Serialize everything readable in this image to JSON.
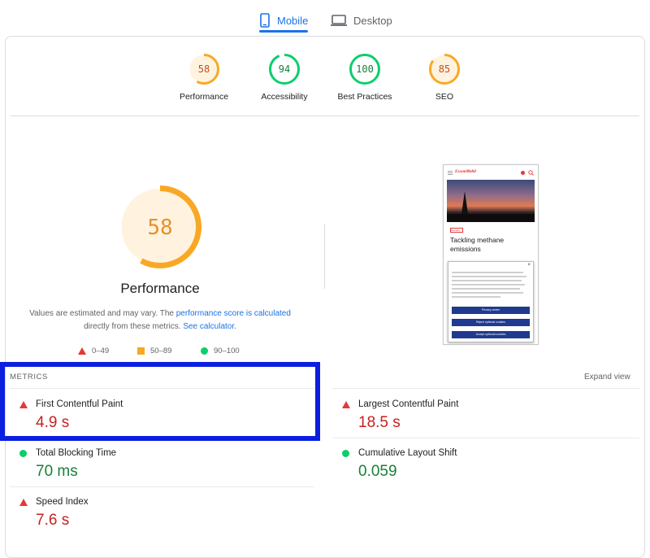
{
  "tabs": {
    "mobile": "Mobile",
    "desktop": "Desktop"
  },
  "categories": [
    {
      "score": "58",
      "label": "Performance",
      "value": 0.58,
      "color": "#f9a825",
      "fill": "#fff3e0",
      "text": "#c0501f"
    },
    {
      "score": "94",
      "label": "Accessibility",
      "value": 0.94,
      "color": "#0cce6b",
      "fill": "#ffffff",
      "text": "#188038"
    },
    {
      "score": "100",
      "label": "Best Practices",
      "value": 1.0,
      "color": "#0cce6b",
      "fill": "#ffffff",
      "text": "#188038"
    },
    {
      "score": "85",
      "label": "SEO",
      "value": 0.85,
      "color": "#f9a825",
      "fill": "#fff3e0",
      "text": "#c0501f"
    }
  ],
  "main": {
    "score": "58",
    "value": 0.58,
    "title": "Performance",
    "note_prefix": "Values are estimated and may vary. The ",
    "note_link1": "performance score is calculated",
    "note_mid": " directly from these metrics. ",
    "note_link2": "See calculator",
    "note_end": "."
  },
  "legend": [
    {
      "icon": "triangle",
      "label": "0–49"
    },
    {
      "icon": "square",
      "label": "50–89"
    },
    {
      "icon": "circle",
      "label": "90–100"
    }
  ],
  "preview": {
    "brand": "ExxonMobil",
    "tag": "Methane",
    "headline": "Tackling methane emissions",
    "buttons": [
      "Privacy center",
      "Reject optional cookies",
      "Accept optional cookies"
    ]
  },
  "metrics": {
    "header": "METRICS",
    "expand": "Expand view",
    "fcp": {
      "name": "First Contentful Paint",
      "value": "4.9 s",
      "status": "poor"
    },
    "lcp": {
      "name": "Largest Contentful Paint",
      "value": "18.5 s",
      "status": "poor"
    },
    "tbt": {
      "name": "Total Blocking Time",
      "value": "70 ms",
      "status": "good"
    },
    "cls": {
      "name": "Cumulative Layout Shift",
      "value": "0.059",
      "status": "good"
    },
    "si": {
      "name": "Speed Index",
      "value": "7.6 s",
      "status": "poor"
    }
  },
  "colors": {
    "accent": "#1a73e8",
    "poor": "#e53935",
    "average": "#f9a825",
    "good": "#0cce6b",
    "highlight": "#0a1fe0"
  }
}
